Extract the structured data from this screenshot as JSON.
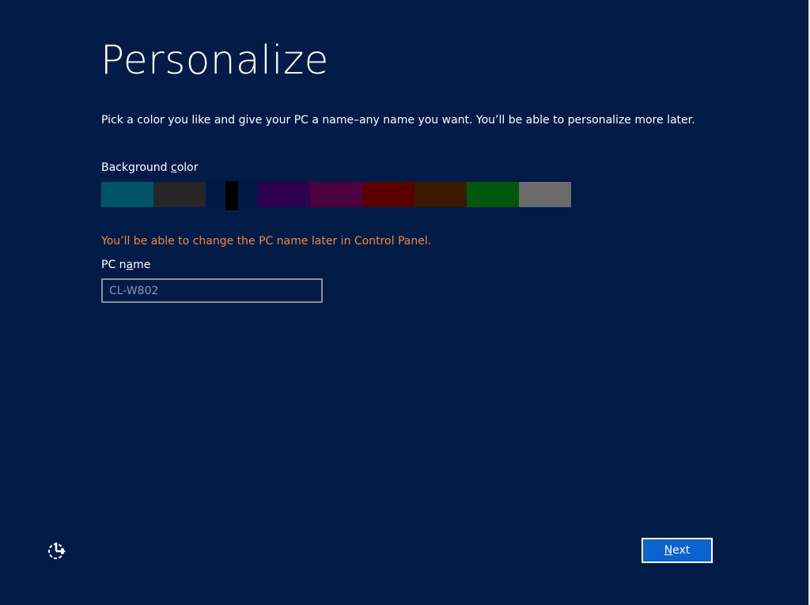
{
  "page": {
    "title": "Personalize",
    "intro": "Pick a color you like and give your PC a name–any name you want. You’ll be able to personalize more later."
  },
  "background": {
    "label_pre": "Background ",
    "label_accel": "c",
    "label_post": "olor",
    "swatches": [
      "#005569",
      "#262626",
      "#001a47",
      "#2d0050",
      "#4d0040",
      "#5a0000",
      "#3b1800",
      "#00590b",
      "#6b6b6b"
    ],
    "selected_index": 2
  },
  "pc": {
    "warning": "You’ll be able to change the PC name later in Control Panel.",
    "label_pre": "PC n",
    "label_accel": "a",
    "label_post": "me",
    "value": "",
    "placeholder": "CL-W802"
  },
  "footer": {
    "ease_icon": "ease-of-access-icon",
    "next_accel": "N",
    "next_post": "ext"
  },
  "colors": {
    "background": "#031b47",
    "accent": "#0a63cf",
    "warning": "#f0883a"
  }
}
